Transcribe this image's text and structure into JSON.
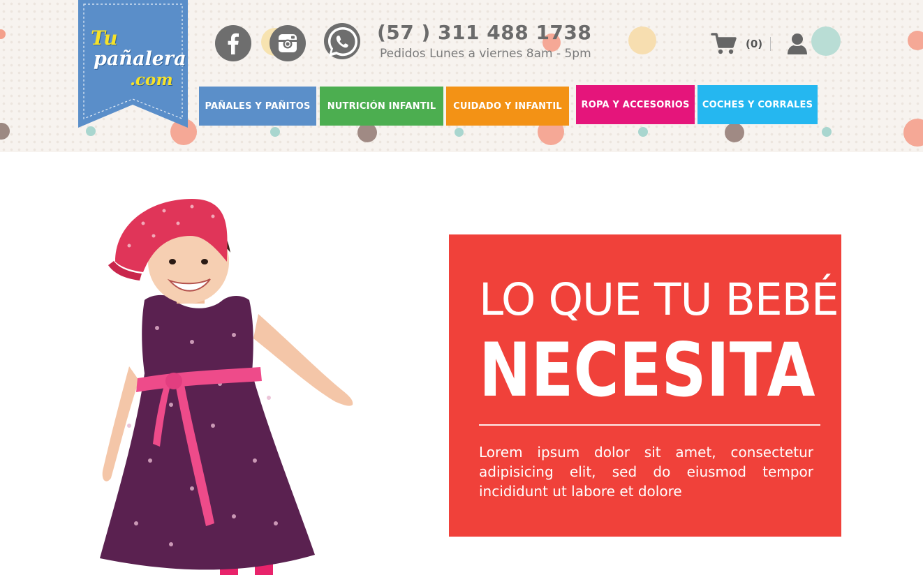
{
  "brand": {
    "logo_line1": "Tu",
    "logo_line2": "pañalera",
    "logo_line3": ".com",
    "ribbon_color": "#5a8ec9"
  },
  "social": [
    {
      "name": "facebook-icon"
    },
    {
      "name": "instagram-icon"
    },
    {
      "name": "whatsapp-icon"
    }
  ],
  "contact": {
    "phone": "(57 ) 311 488 1738",
    "hours": "Pedidos Lunes a viernes 8am - 5pm"
  },
  "cart": {
    "icon": "cart-icon",
    "count": "(0)"
  },
  "account": {
    "icon": "user-icon"
  },
  "nav": [
    {
      "label": "PAÑALES Y PAÑITOS",
      "color": "#5b8fc9"
    },
    {
      "label": "NUTRICIÓN INFANTIL",
      "color": "#4cae50"
    },
    {
      "label": "CUIDADO Y INFANTIL",
      "color": "#f39215"
    },
    {
      "label": "ROPA Y ACCESORIOS",
      "color": "#e5157b"
    },
    {
      "label": "COCHES Y CORRALES",
      "color": "#25b7f0"
    }
  ],
  "hero": {
    "headline_top": "LO QUE TU BEBÉ",
    "headline_main": "NECESITA",
    "body": "Lorem ipsum dolor sit amet, consectetur adipisicing elit, sed do eiusmod tempor incididunt ut labore et dolore",
    "panel_color": "#f0413a"
  }
}
